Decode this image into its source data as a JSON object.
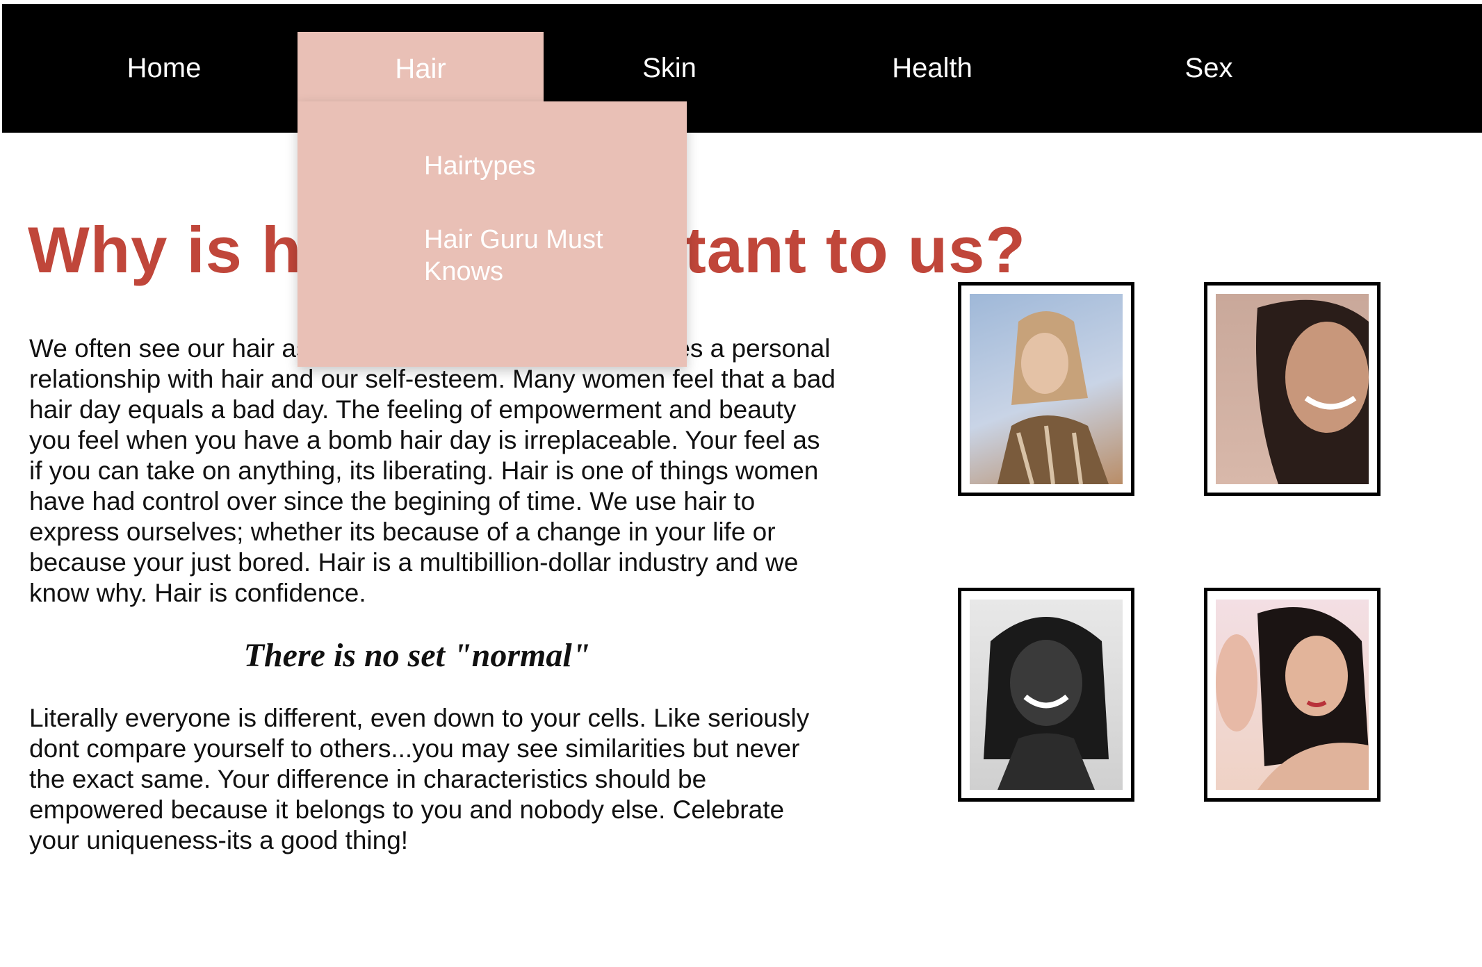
{
  "nav": {
    "home": "Home",
    "hair": "Hair",
    "skin": "Skin",
    "health": "Health",
    "sex": "Sex"
  },
  "dropdown": {
    "items": [
      "Hairtypes",
      "Hair Guru Must Knows"
    ]
  },
  "main": {
    "heading": "Why is hair so important to us?",
    "paragraph1": "We often see our hair as something that defines us. Theres a personal relationship with hair and our self-esteem. Many women feel that a bad hair day equals a bad day. The feeling of empowerment and beauty you feel when you have a bomb hair day is irreplaceable. Your feel as if you can take on anything, its liberating. Hair is one of things women have had control over since the begining of time. We use hair to express ourselves; whether its because of a change in your life or because your just bored. Hair is a multibillion-dollar industry and we know why. Hair is confidence.",
    "quote": "There is no set \"normal\"",
    "paragraph2": "Literally everyone is different, even down to your cells. Like seriously dont compare yourself to others...you may see similarities but never the exact same. Your difference in characteristics should be empowered because it belongs to you and nobody else. Celebrate your uniqueness-its a good thing!"
  },
  "colors": {
    "nav_bg": "#000000",
    "accent_pink": "#e9c0b6",
    "heading_red": "#c0463a"
  }
}
